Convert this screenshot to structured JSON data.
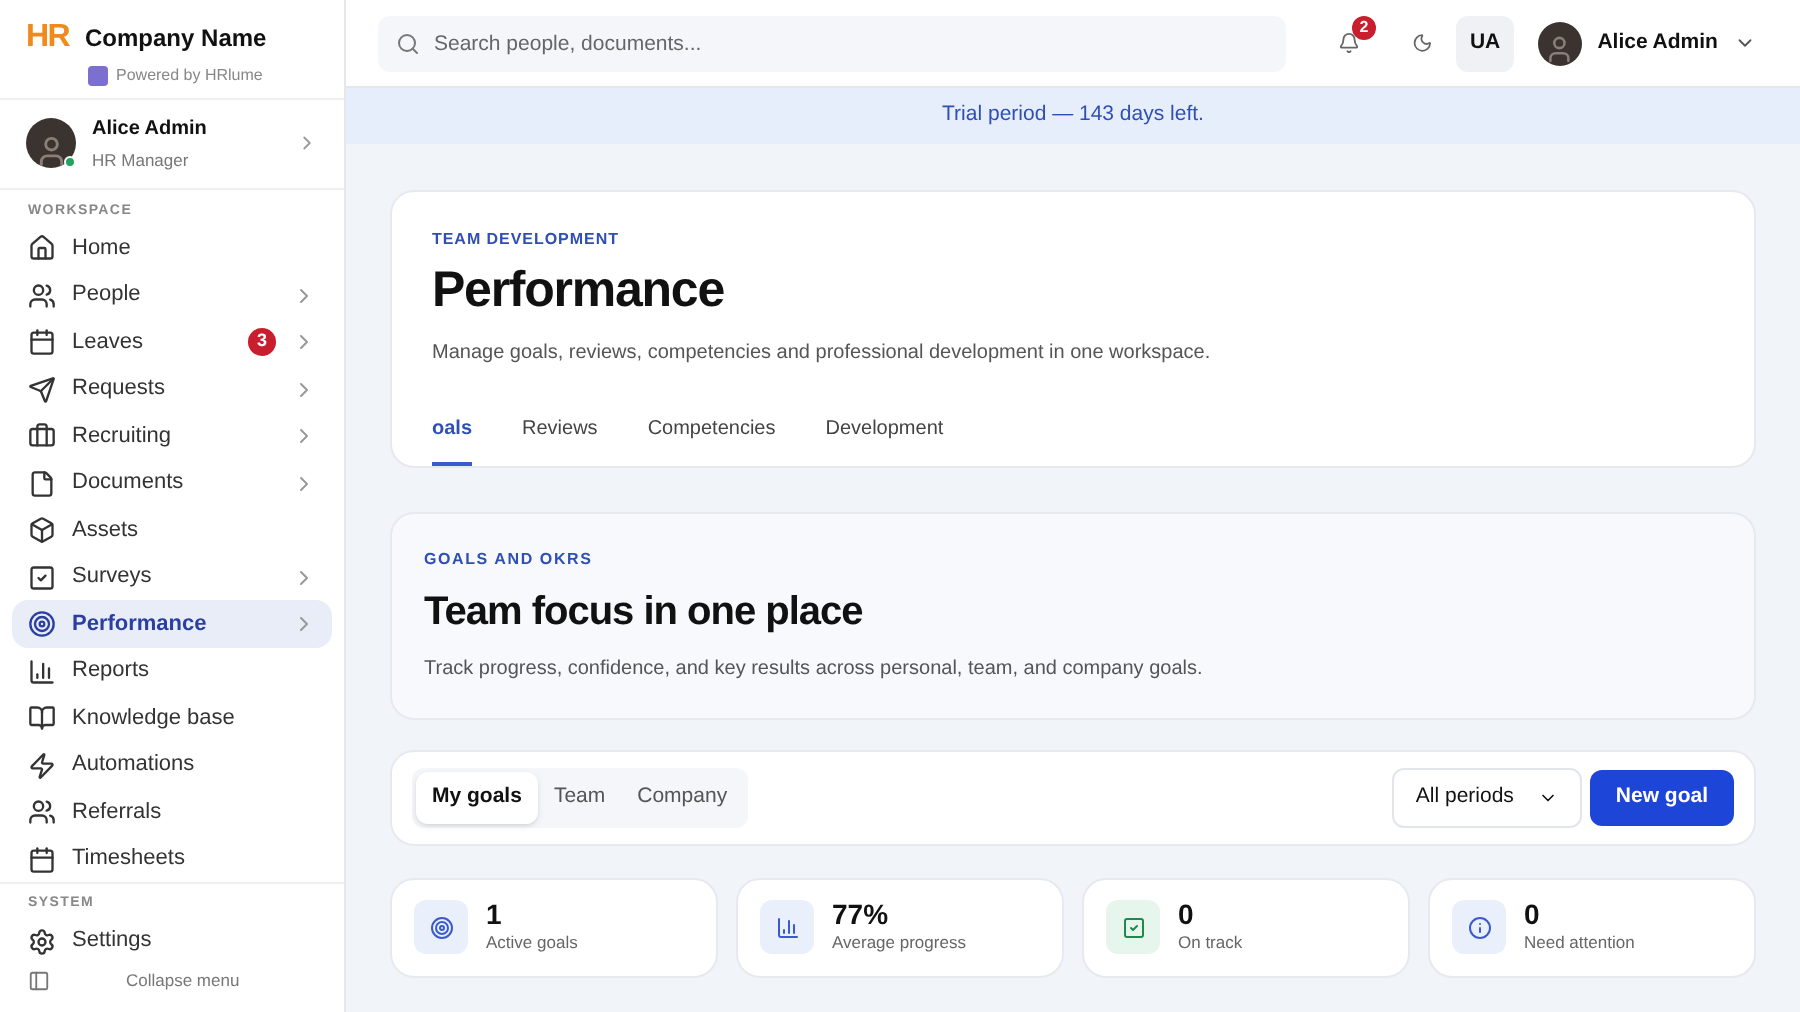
{
  "brand": {
    "name": "Company Name",
    "logo": "HR",
    "powered_by": "Powered by HRlume"
  },
  "user_card": {
    "name": "Alice Admin",
    "role": "HR Manager",
    "online": true
  },
  "sidebar": {
    "sections": [
      {
        "title": "WORKSPACE",
        "items": [
          {
            "label": "Home",
            "has_submenu": false,
            "selected": false
          },
          {
            "label": "People",
            "has_submenu": true,
            "selected": false
          },
          {
            "label": "Leaves",
            "has_submenu": true,
            "selected": false,
            "badge": "3"
          },
          {
            "label": "Requests",
            "has_submenu": true,
            "selected": false
          },
          {
            "label": "Recruiting",
            "has_submenu": true,
            "selected": false
          },
          {
            "label": "Documents",
            "has_submenu": true,
            "selected": false
          },
          {
            "label": "Assets",
            "has_submenu": false,
            "selected": false
          },
          {
            "label": "Surveys",
            "has_submenu": true,
            "selected": false
          },
          {
            "label": "Performance",
            "has_submenu": true,
            "selected": true
          },
          {
            "label": "Reports",
            "has_submenu": false,
            "selected": false
          },
          {
            "label": "Knowledge base",
            "has_submenu": false,
            "selected": false
          },
          {
            "label": "Automations",
            "has_submenu": false,
            "selected": false
          },
          {
            "label": "Referrals",
            "has_submenu": false,
            "selected": false
          },
          {
            "label": "Timesheets",
            "has_submenu": false,
            "selected": false
          }
        ]
      },
      {
        "title": "SYSTEM",
        "items": [
          {
            "label": "Settings",
            "has_submenu": false,
            "selected": false
          }
        ]
      }
    ],
    "collapse": "Collapse menu"
  },
  "topbar": {
    "search": {
      "placeholder": "Search people, documents..."
    },
    "notifications": "2",
    "initials": "UA",
    "user": "Alice Admin"
  },
  "banner": "Trial period — 143 days left.",
  "header": {
    "eyebrow": "TEAM DEVELOPMENT",
    "title": "Performance",
    "description": "Manage goals, reviews, competencies and professional development in one workspace.",
    "tabs": [
      {
        "label": "oals",
        "selected": true
      },
      {
        "label": "Reviews",
        "selected": false
      },
      {
        "label": "Competencies",
        "selected": false
      },
      {
        "label": "Development",
        "selected": false
      }
    ]
  },
  "hero": {
    "eyebrow": "GOALS AND OKRS",
    "title": "Team focus in one place",
    "description": "Track progress, confidence, and key results across personal, team, and company goals."
  },
  "toolbar": {
    "scopes": [
      {
        "label": "My goals",
        "selected": true
      },
      {
        "label": "Team",
        "selected": false
      },
      {
        "label": "Company",
        "selected": false
      }
    ],
    "period": "All periods",
    "new_button": "New goal"
  },
  "stats": [
    {
      "kind": "target",
      "value": "1",
      "label": "Active goals"
    },
    {
      "kind": "chart",
      "value": "77%",
      "label": "Average progress"
    },
    {
      "kind": "check",
      "value": "0",
      "label": "On track"
    },
    {
      "kind": "info",
      "value": "0",
      "label": "Need attention"
    }
  ]
}
